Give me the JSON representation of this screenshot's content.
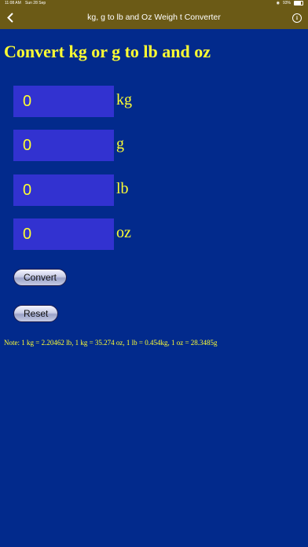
{
  "status_bar": {
    "time": "11:08 AM",
    "date": "Sun 28 Sep",
    "battery": "93%"
  },
  "nav": {
    "title": "kg, g to lb and Oz Weigh t Converter",
    "back_icon": "chevron-left-icon",
    "info_icon": "info-icon"
  },
  "main": {
    "title": "Convert kg or g to lb and oz",
    "fields": [
      {
        "value": "0",
        "unit": "kg"
      },
      {
        "value": "0",
        "unit": "g"
      },
      {
        "value": "0",
        "unit": "lb"
      },
      {
        "value": "0",
        "unit": "oz"
      }
    ],
    "convert_label": "Convert",
    "reset_label": "Reset",
    "note": "Note: 1 kg = 2.20462 lb, 1 kg = 35.274 oz, 1 lb = 0.454kg, 1 oz = 28.3485g"
  },
  "colors": {
    "background": "#022a8c",
    "header": "#6b5a16",
    "accent_text": "#ffff33",
    "field_bg": "#3232d0"
  }
}
